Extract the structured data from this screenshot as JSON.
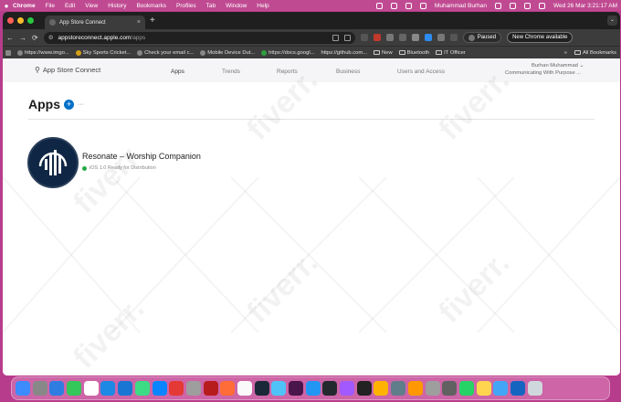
{
  "menubar": {
    "app": "Chrome",
    "items": [
      "File",
      "Edit",
      "View",
      "History",
      "Bookmarks",
      "Profiles",
      "Tab",
      "Window",
      "Help"
    ],
    "user": "Muhammad Burhan",
    "datetime": "Wed 26 Mar  3:21:17 AM"
  },
  "tab": {
    "title": "App Store Connect",
    "close": "×",
    "new_tab": "+",
    "menu": "⌄"
  },
  "toolbar": {
    "back": "←",
    "forward": "→",
    "reload": "⟳",
    "url_host": "appstoreconnect.apple.com",
    "url_path": "/apps",
    "paused_label": "Paused",
    "update_label": "New Chrome available"
  },
  "bookmarks": {
    "items": [
      "https://www.imgo...",
      "Sky Sports Cricket...",
      "Check your email c...",
      "Mobile Device Dut...",
      "https://docs.googl...",
      "https://github.com...",
      "New",
      "Bluetooth",
      "IT Officer"
    ],
    "overflow": "»",
    "all_label": "All Bookmarks"
  },
  "asc_nav": {
    "brand": "App Store Connect",
    "links": [
      "Apps",
      "Trends",
      "Reports",
      "Business",
      "Users and Access"
    ],
    "user_name": "Burhan Muhammad",
    "user_org": "Communicating With Purpose ..."
  },
  "apps_page": {
    "title": "Apps",
    "add": "+",
    "more": "···",
    "app_name": "Resonate – Worship Companion",
    "app_status": "iOS 1.0 Ready for Distribution"
  },
  "watermark": {
    "text": "fiverr."
  },
  "colors": {
    "menubar": "#c04a92",
    "chrome_dark": "#1f1f1f",
    "toolbar": "#3c3c3c",
    "accent": "#0070c9",
    "status_green": "#28a745",
    "app_icon": "#0f2744"
  },
  "dock": {
    "icons": [
      "finder-icon",
      "launchpad-icon",
      "mail-icon",
      "messages-icon",
      "calendar-icon",
      "vscode-icon",
      "xcode-icon",
      "android-studio-icon",
      "app-store-icon",
      "chrome-icon",
      "box-icon",
      "filezilla-icon",
      "postman-icon",
      "notion-icon",
      "steam-icon",
      "testflight-icon",
      "slack-icon",
      "sourcetree-icon",
      "github-icon",
      "figma-icon",
      "terminal-icon",
      "tableplus-icon",
      "quicktime-icon",
      "keynote-icon",
      "settings-icon",
      "calculator-icon",
      "whatsapp-icon",
      "notes-icon",
      "folder-icon",
      "downloads-icon",
      "trash-icon"
    ]
  }
}
